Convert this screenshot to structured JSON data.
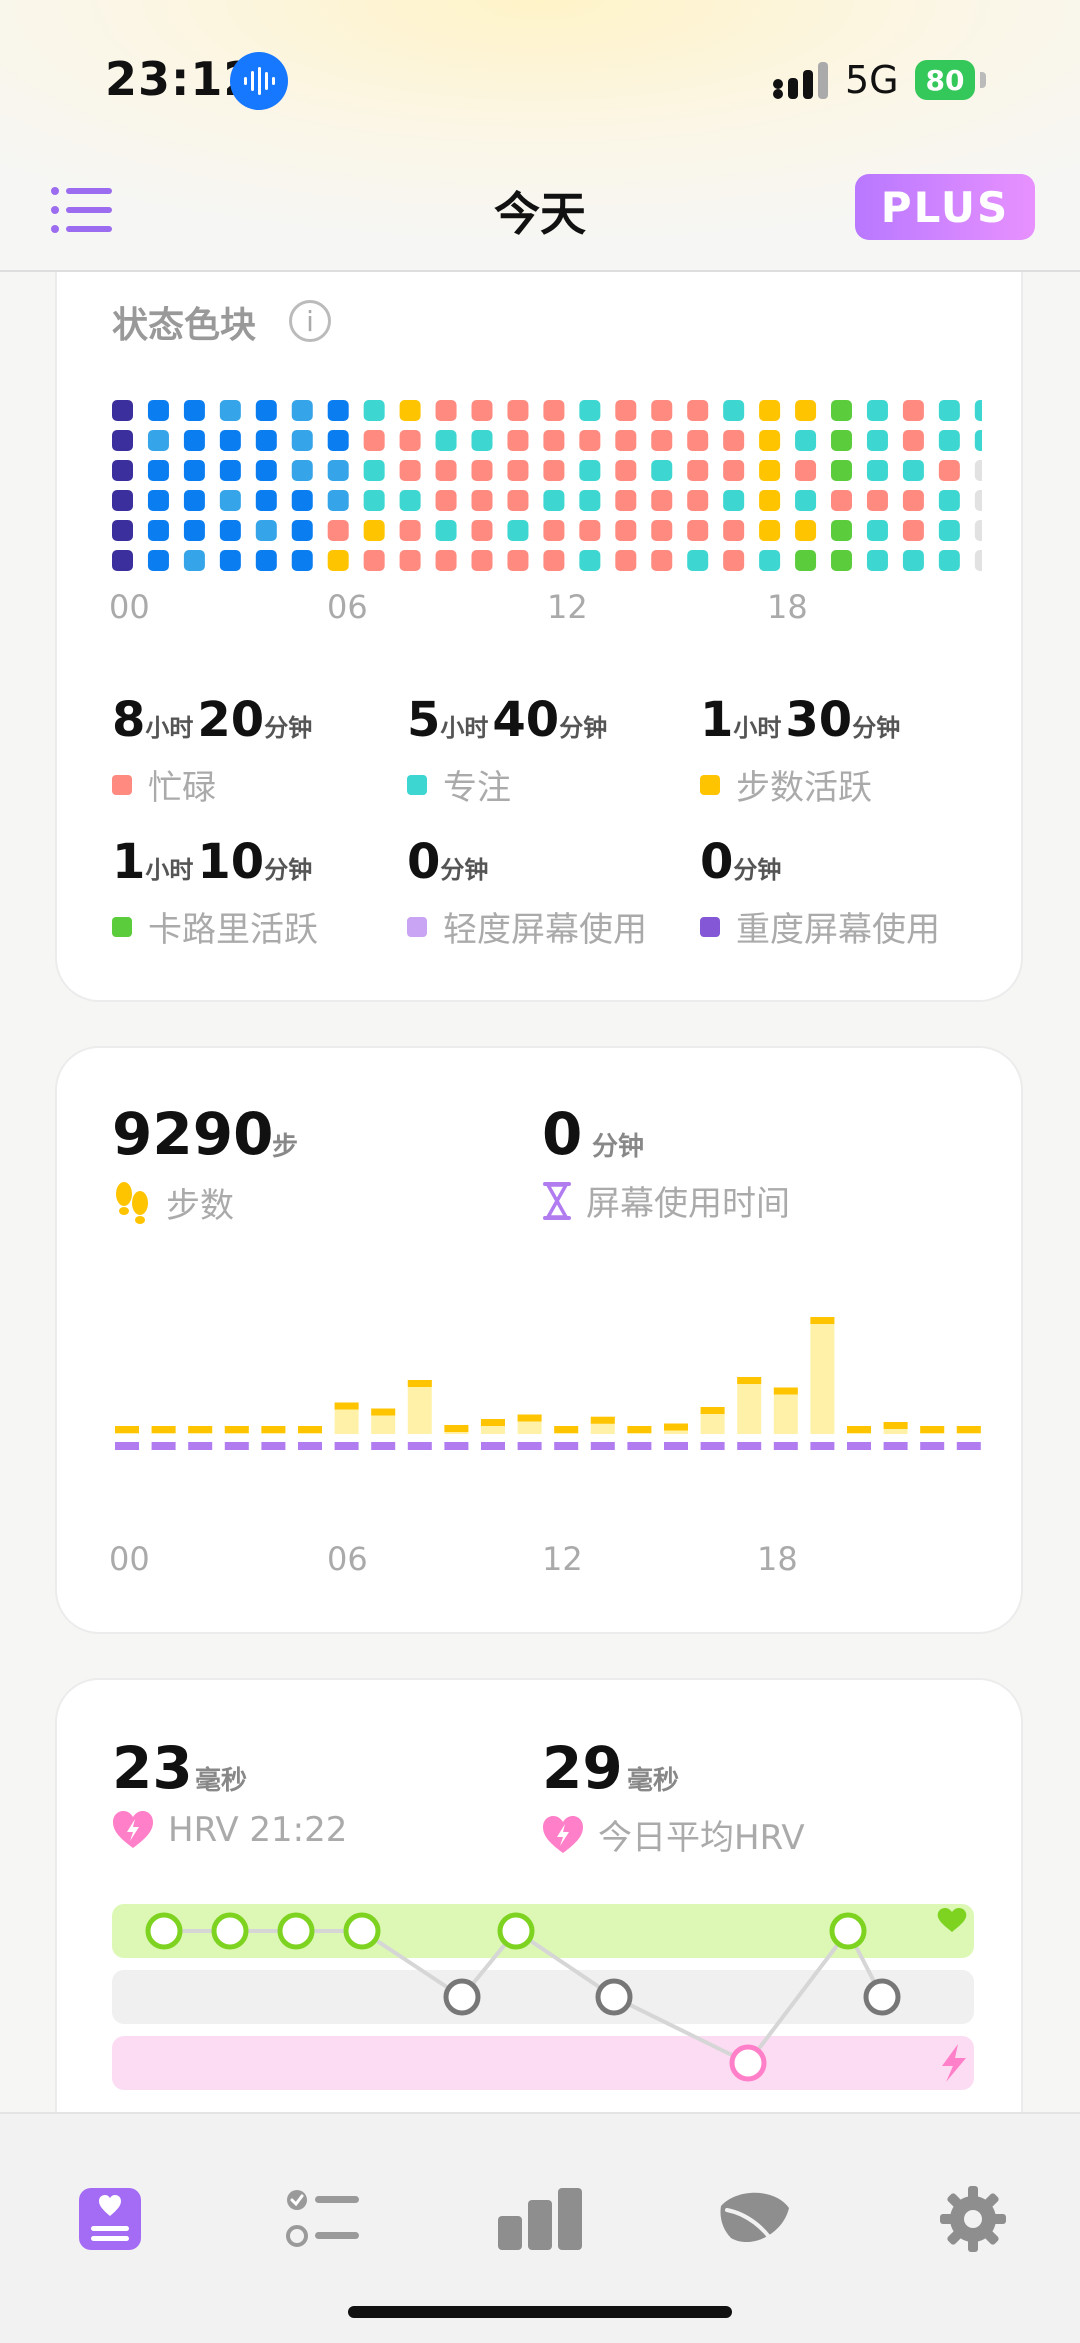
{
  "status_bar": {
    "time": "23:12",
    "network": "5G",
    "battery": "80"
  },
  "nav": {
    "title": "今天",
    "plus_label": "PLUS"
  },
  "status_blocks": {
    "title": "状态色块",
    "hour_ticks": [
      "00",
      "06",
      "12",
      "18"
    ],
    "colors": {
      "D": "#3b2f9e",
      "B": "#0a7df0",
      "L": "#35a4e8",
      "C": "#ff8a80",
      "T": "#3dd6d0",
      "Y": "#ffc400",
      "G": "#5bcc3c",
      "E": "#e2e2e2",
      "M": "#38e0dc"
    },
    "columns": [
      "DDDDDD",
      "BLBBBB",
      "BBBBBL",
      "LBBLBB",
      "BBBBLB",
      "LLLBBB",
      "BBLLCY",
      "TCTTYC",
      "YCCTCC",
      "CTCCTC",
      "CTCCCC",
      "CCCCTC",
      "CCCTCC",
      "TCTTCT",
      "CCCCCC",
      "CCTCCC",
      "CCCCCT",
      "TCCTCC",
      "YYYYYT",
      "YTCTYG",
      "GGGCGG",
      "TTTCTT",
      "CCTCCT",
      "TTCTTT",
      "TTEEEE"
    ],
    "stats": [
      {
        "h": "8",
        "h_unit": "小时",
        "m": "20",
        "m_unit": "分钟",
        "label": "忙碌",
        "color": "#ff8a80"
      },
      {
        "h": "5",
        "h_unit": "小时",
        "m": "40",
        "m_unit": "分钟",
        "label": "专注",
        "color": "#3dd6d0"
      },
      {
        "h": "1",
        "h_unit": "小时",
        "m": "30",
        "m_unit": "分钟",
        "label": "步数活跃",
        "color": "#ffc400"
      },
      {
        "h": "1",
        "h_unit": "小时",
        "m": "10",
        "m_unit": "分钟",
        "label": "卡路里活跃",
        "color": "#5bcc3c"
      },
      {
        "h": "0",
        "h_unit": "",
        "m": "",
        "m_unit": "分钟",
        "label": "轻度屏幕使用",
        "color": "#c9a4f5"
      },
      {
        "h": "0",
        "h_unit": "",
        "m": "",
        "m_unit": "分钟",
        "label": "重度屏幕使用",
        "color": "#8457d6"
      }
    ]
  },
  "activity": {
    "steps_value": "9290",
    "steps_unit": "步",
    "steps_label": "步数",
    "screen_value": "0",
    "screen_unit": "分钟",
    "screen_label": "屏幕使用时间"
  },
  "hrv": {
    "latest_value": "23",
    "latest_unit": "毫秒",
    "latest_label": "HRV 21:22",
    "avg_value": "29",
    "avg_unit": "毫秒",
    "avg_label": "今日平均HRV"
  },
  "chart_data": [
    {
      "type": "bar",
      "title": "",
      "xlabel": "",
      "ylabel": "",
      "x_ticks": [
        "00",
        "06",
        "12",
        "18"
      ],
      "categories": [
        "0",
        "1",
        "2",
        "3",
        "4",
        "5",
        "6",
        "7",
        "8",
        "9",
        "10",
        "11",
        "12",
        "13",
        "14",
        "15",
        "16",
        "17",
        "18",
        "19",
        "20",
        "21",
        "22",
        "23"
      ],
      "series": [
        {
          "name": "步数",
          "color": "#ffc400",
          "values": [
            60,
            60,
            60,
            60,
            60,
            60,
            420,
            340,
            720,
            120,
            200,
            260,
            60,
            230,
            80,
            140,
            360,
            760,
            620,
            1560,
            60,
            160,
            60,
            60
          ]
        },
        {
          "name": "屏幕使用时间",
          "color": "#b07cf0",
          "values": [
            0,
            0,
            0,
            0,
            0,
            0,
            0,
            0,
            0,
            0,
            0,
            0,
            0,
            0,
            0,
            0,
            0,
            0,
            0,
            0,
            0,
            0,
            0,
            0
          ]
        }
      ]
    }
  ],
  "hrv_chart": {
    "levels_description": [
      "good",
      "normal",
      "stressed"
    ],
    "points": [
      0,
      0,
      0,
      0,
      1,
      0,
      1,
      2,
      0,
      1
    ]
  },
  "tabs": [
    {
      "name": "tab-today",
      "icon": "journal-icon",
      "active": true
    },
    {
      "name": "tab-tasks",
      "icon": "checklist-icon",
      "active": false
    },
    {
      "name": "tab-stats",
      "icon": "bar-chart-icon",
      "active": false
    },
    {
      "name": "tab-nature",
      "icon": "leaf-icon",
      "active": false
    },
    {
      "name": "tab-settings",
      "icon": "gear-icon",
      "active": false
    }
  ]
}
